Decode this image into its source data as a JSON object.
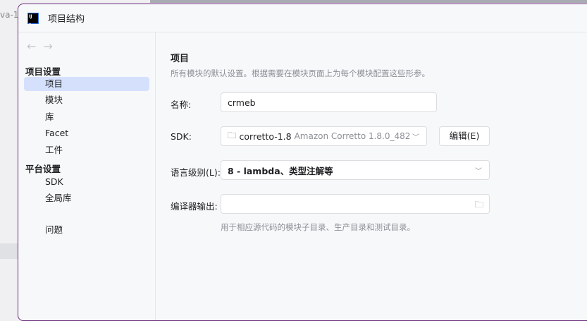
{
  "background": {
    "partial_text": "va-1."
  },
  "window": {
    "title": "项目结构"
  },
  "sidebar": {
    "groups": [
      {
        "label": "项目设置"
      },
      {
        "label": "平台设置"
      }
    ],
    "items": [
      {
        "label": "项目"
      },
      {
        "label": "模块"
      },
      {
        "label": "库"
      },
      {
        "label": "Facet"
      },
      {
        "label": "工件"
      },
      {
        "label": "SDK"
      },
      {
        "label": "全局库"
      },
      {
        "label": "问题"
      }
    ]
  },
  "main": {
    "heading": "项目",
    "description": "所有模块的默认设置。根据需要在模块页面上为每个模块配置这些形参。",
    "name_label": "名称:",
    "name_value": "crmeb",
    "sdk_label": "SDK:",
    "sdk_name": "corretto-1.8",
    "sdk_detail": "Amazon Corretto 1.8.0_482",
    "edit_button": "编辑(E)",
    "lang_label": "语言级别(L):",
    "lang_value": "8 - lambda、类型注解等",
    "output_label": "编译器输出:",
    "output_value": "",
    "output_hint": "用于相应源代码的模块子目录、生产目录和测试目录。"
  }
}
